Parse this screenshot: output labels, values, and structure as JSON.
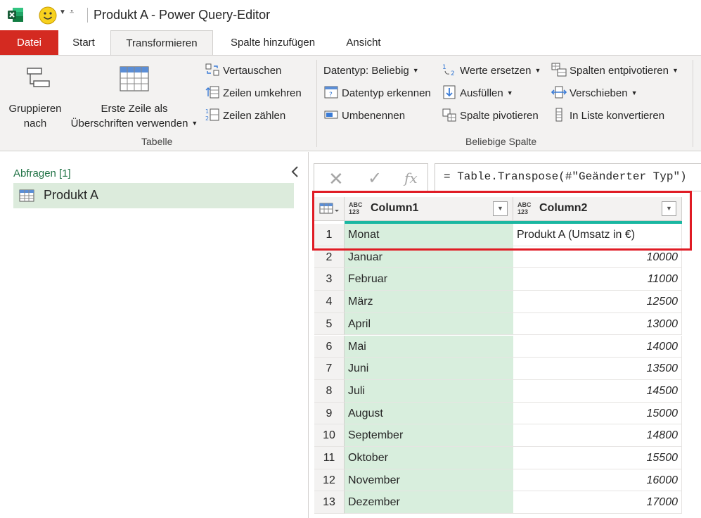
{
  "window": {
    "title": "Produkt A - Power Query-Editor"
  },
  "tabs": [
    {
      "label": "Datei"
    },
    {
      "label": "Start"
    },
    {
      "label": "Transformieren"
    },
    {
      "label": "Spalte hinzufügen"
    },
    {
      "label": "Ansicht"
    }
  ],
  "ribbon": {
    "tabelle": {
      "group_label": "Tabelle",
      "gruppieren_line1": "Gruppieren",
      "gruppieren_line2": "nach",
      "erste_zeile_line1": "Erste Zeile als",
      "erste_zeile_line2": "Überschriften verwenden",
      "vertauschen": "Vertauschen",
      "zeilen_umkehren": "Zeilen umkehren",
      "zeilen_zaehlen": "Zeilen zählen"
    },
    "beliebige_spalte": {
      "group_label": "Beliebige Spalte",
      "datentyp": "Datentyp: Beliebig",
      "datentyp_erkennen": "Datentyp erkennen",
      "umbenennen": "Umbenennen",
      "werte_ersetzen": "Werte ersetzen",
      "ausfuellen": "Ausfüllen",
      "spalte_pivotieren": "Spalte pivotieren",
      "spalten_entpivotieren": "Spalten entpivotieren",
      "verschieben": "Verschieben",
      "in_liste": "In Liste konvertieren"
    }
  },
  "queries": {
    "header": "Abfragen [1]",
    "items": [
      {
        "label": "Produkt A"
      }
    ]
  },
  "formula": {
    "fx_label": "fx",
    "text": "= Table.Transpose(#\"Geänderter Typ\")"
  },
  "grid": {
    "type_badge_top": "ABC",
    "type_badge_bottom": "123",
    "columns": [
      "Column1",
      "Column2"
    ],
    "rows": [
      {
        "n": "1",
        "c1": "Monat",
        "c2": "Produkt A (Umsatz in €)"
      },
      {
        "n": "2",
        "c1": "Januar",
        "c2": "10000"
      },
      {
        "n": "3",
        "c1": "Februar",
        "c2": "11000"
      },
      {
        "n": "4",
        "c1": "März",
        "c2": "12500"
      },
      {
        "n": "5",
        "c1": "April",
        "c2": "13000"
      },
      {
        "n": "6",
        "c1": "Mai",
        "c2": "14000"
      },
      {
        "n": "7",
        "c1": "Juni",
        "c2": "13500"
      },
      {
        "n": "8",
        "c1": "Juli",
        "c2": "14500"
      },
      {
        "n": "9",
        "c1": "August",
        "c2": "15000"
      },
      {
        "n": "10",
        "c1": "September",
        "c2": "14800"
      },
      {
        "n": "11",
        "c1": "Oktober",
        "c2": "15500"
      },
      {
        "n": "12",
        "c1": "November",
        "c2": "16000"
      },
      {
        "n": "13",
        "c1": "Dezember",
        "c2": "17000"
      }
    ]
  },
  "colors": {
    "file_tab": "#d42a21",
    "query_selected": "#dcebdc",
    "column_highlight": "#d8eedd",
    "quality_bar": "#1ab7a1",
    "highlight_box": "#e01b24"
  }
}
